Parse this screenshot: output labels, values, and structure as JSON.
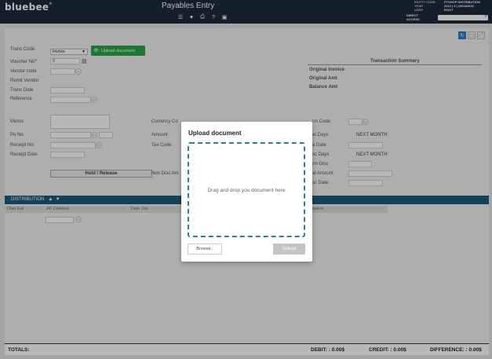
{
  "header": {
    "logo": "bluebee",
    "logo_mark": "®",
    "title": "Payables Entry",
    "meta_labels": [
      "ENTITY CODE",
      "YEAR",
      "USER"
    ],
    "meta_values": [
      "PTSHOP DISTRIBUTION",
      "2013 | 3 | 15/04/2026",
      "ROOT"
    ],
    "direct_access_1": "DIRECT",
    "direct_access_2": "ACCESS",
    "search_placeholder": ""
  },
  "form": {
    "trans_code_label": "Trans Code",
    "trans_code_value": "Invoice",
    "upload_button": "Upload document",
    "voucher_no_label": "Voucher No",
    "voucher_no_value": "0",
    "vendor_code_label": "Vendor code",
    "remit_vendor_label": "Remit Vendor",
    "trans_date_label": "Trans Date",
    "reference_label": "Reference",
    "memo_label": "Memo",
    "currency_label": "Currency Co",
    "term_code_label": "rm Code",
    "po_no_label": "Po No",
    "amount_label": "Amount",
    "net_days_label": "et Days",
    "net_days_value": "NEXT MONTH",
    "receipt_no_label": "Receipt No",
    "tax_code_label": "Tax Code",
    "due_date_label": "e Date",
    "receipt_date_label": "Receipt Date",
    "disc_days_label": "sc Days",
    "disc_days_value": "NEXT MONTH",
    "term_disc_label": "rm Disc",
    "hold_release": "Hold / Release",
    "non_disc_label": "Non Disc Am",
    "disc_amount_label": "al Amount",
    "disc_date_label": "sc Date"
  },
  "summary": {
    "title": "Transaction Summary",
    "original_invoice": "Original Invoice",
    "original_amt": "Original Amt",
    "balance_amt": "Balance Amt"
  },
  "distribution": {
    "title": "DISTRIBUTION",
    "columns": [
      "Distr Ent",
      "AP Distribut",
      "Distr Job",
      "mation"
    ]
  },
  "totals": {
    "label": "TOTALS:",
    "debit": "DEBIT: : 0.00$",
    "credit": "CREDIT: : 0.00$",
    "difference": "DIFFERENCE: : 0.00$"
  },
  "modal": {
    "title": "Upload document",
    "drop_text": "Drag and drop you document here",
    "browse": "Browse..",
    "upload": "Upload"
  }
}
